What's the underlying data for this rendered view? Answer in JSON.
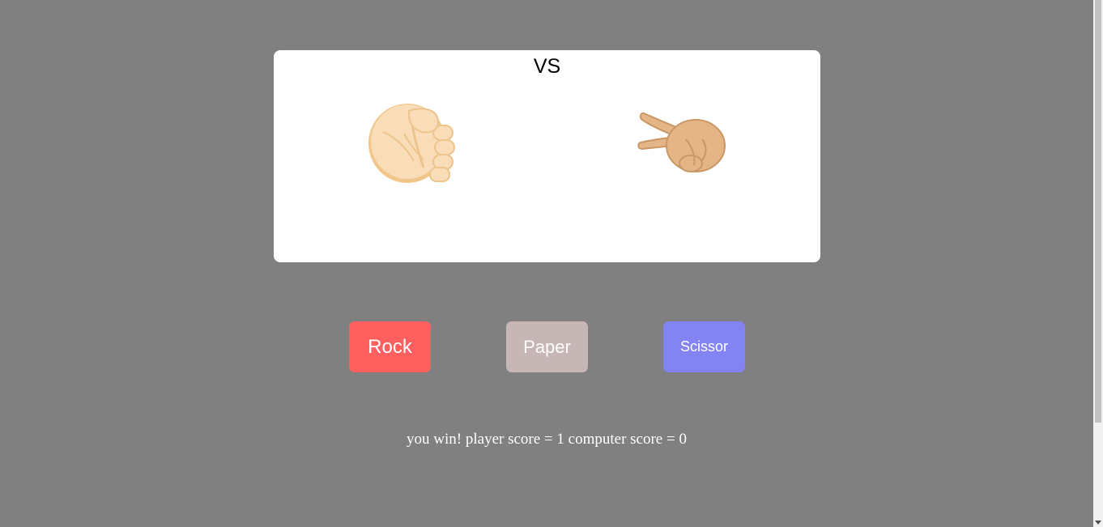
{
  "arena": {
    "vs_label": "VS"
  },
  "player_choice": {
    "icon": "rock-fist-icon"
  },
  "computer_choice": {
    "icon": "scissors-hand-icon"
  },
  "buttons": {
    "rock_label": "Rock",
    "paper_label": "Paper",
    "scissor_label": "Scissor"
  },
  "result": {
    "message": "you win! player score = 1 computer score = 0",
    "player_score": 1,
    "computer_score": 0
  },
  "colors": {
    "background": "#808080",
    "rock": "#ff5f5f",
    "paper": "#c7b6b6",
    "scissor": "#8383f3"
  }
}
